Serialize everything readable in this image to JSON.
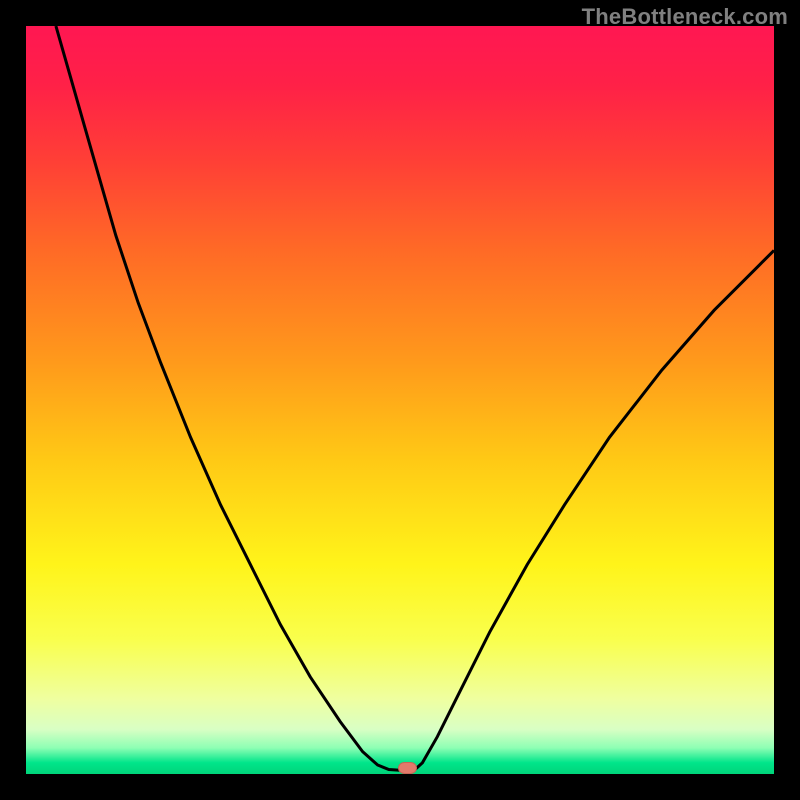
{
  "watermark": "TheBottleneck.com",
  "chart_data": {
    "type": "line",
    "title": "",
    "xlabel": "",
    "ylabel": "",
    "xlim": [
      0,
      100
    ],
    "ylim": [
      0,
      100
    ],
    "background_gradient": {
      "stops": [
        {
          "pos": 0.0,
          "color": "#ff1752"
        },
        {
          "pos": 0.08,
          "color": "#ff2147"
        },
        {
          "pos": 0.18,
          "color": "#ff3f36"
        },
        {
          "pos": 0.3,
          "color": "#ff6a26"
        },
        {
          "pos": 0.45,
          "color": "#ff9a1b"
        },
        {
          "pos": 0.58,
          "color": "#ffc915"
        },
        {
          "pos": 0.72,
          "color": "#fff41a"
        },
        {
          "pos": 0.82,
          "color": "#f9ff4d"
        },
        {
          "pos": 0.9,
          "color": "#efffa0"
        },
        {
          "pos": 0.94,
          "color": "#d9ffc4"
        },
        {
          "pos": 0.965,
          "color": "#8effb4"
        },
        {
          "pos": 0.985,
          "color": "#00e58a"
        },
        {
          "pos": 1.0,
          "color": "#00d47a"
        }
      ]
    },
    "series": [
      {
        "name": "bottleneck-curve",
        "stroke": "#000000",
        "points": [
          {
            "x": 4.0,
            "y": 100.0
          },
          {
            "x": 6.0,
            "y": 93.0
          },
          {
            "x": 8.0,
            "y": 86.0
          },
          {
            "x": 10.0,
            "y": 79.0
          },
          {
            "x": 12.0,
            "y": 72.0
          },
          {
            "x": 15.0,
            "y": 63.0
          },
          {
            "x": 18.0,
            "y": 55.0
          },
          {
            "x": 22.0,
            "y": 45.0
          },
          {
            "x": 26.0,
            "y": 36.0
          },
          {
            "x": 30.0,
            "y": 28.0
          },
          {
            "x": 34.0,
            "y": 20.0
          },
          {
            "x": 38.0,
            "y": 13.0
          },
          {
            "x": 42.0,
            "y": 7.0
          },
          {
            "x": 45.0,
            "y": 3.0
          },
          {
            "x": 47.0,
            "y": 1.2
          },
          {
            "x": 48.5,
            "y": 0.6
          },
          {
            "x": 50.0,
            "y": 0.5
          },
          {
            "x": 51.0,
            "y": 0.5
          },
          {
            "x": 52.0,
            "y": 0.6
          },
          {
            "x": 53.0,
            "y": 1.5
          },
          {
            "x": 55.0,
            "y": 5.0
          },
          {
            "x": 58.0,
            "y": 11.0
          },
          {
            "x": 62.0,
            "y": 19.0
          },
          {
            "x": 67.0,
            "y": 28.0
          },
          {
            "x": 72.0,
            "y": 36.0
          },
          {
            "x": 78.0,
            "y": 45.0
          },
          {
            "x": 85.0,
            "y": 54.0
          },
          {
            "x": 92.0,
            "y": 62.0
          },
          {
            "x": 98.0,
            "y": 68.0
          },
          {
            "x": 100.0,
            "y": 70.0
          }
        ]
      }
    ],
    "marker": {
      "x": 51.0,
      "y": 0.8,
      "shape": "pill",
      "fill": "#e27a6b",
      "stroke": "#c86556"
    }
  }
}
